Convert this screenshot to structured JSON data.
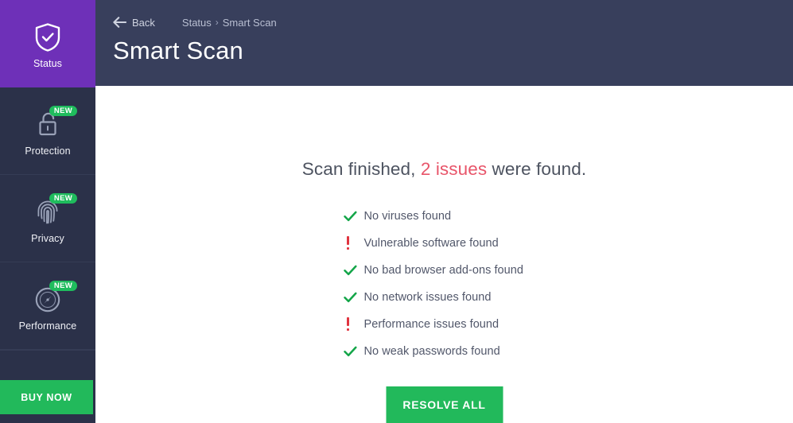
{
  "colors": {
    "sidebar_bg": "#2b3149",
    "sidebar_active": "#6e30b8",
    "header_bg": "#383f5c",
    "accent_green": "#22b95b",
    "badge_green": "#1fbc5d",
    "issue_red": "#e8556a",
    "alert_red": "#e0343f",
    "check_green": "#13a548",
    "content_bg": "#ffffff",
    "body_text": "#51576a"
  },
  "sidebar": {
    "items": [
      {
        "label": "Status",
        "icon": "shield-check-icon",
        "active": true,
        "badge": null
      },
      {
        "label": "Protection",
        "icon": "open-padlock-icon",
        "active": false,
        "badge": "NEW"
      },
      {
        "label": "Privacy",
        "icon": "fingerprint-icon",
        "active": false,
        "badge": "NEW"
      },
      {
        "label": "Performance",
        "icon": "speedometer-icon",
        "active": false,
        "badge": "NEW"
      }
    ],
    "buy_now_label": "BUY NOW"
  },
  "header": {
    "back_label": "Back",
    "back_icon": "arrow-left-icon",
    "breadcrumb": {
      "parent": "Status",
      "separator": "›",
      "current": "Smart Scan"
    },
    "title": "Smart Scan"
  },
  "content": {
    "summary": {
      "prefix": "Scan finished, ",
      "highlight": "2 issues",
      "suffix": " were found."
    },
    "results": [
      {
        "text": "No viruses found",
        "status": "ok",
        "icon": "check-icon"
      },
      {
        "text": "Vulnerable software found",
        "status": "issue",
        "icon": "exclamation-icon"
      },
      {
        "text": "No bad browser add-ons found",
        "status": "ok",
        "icon": "check-icon"
      },
      {
        "text": "No network issues found",
        "status": "ok",
        "icon": "check-icon"
      },
      {
        "text": "Performance issues found",
        "status": "issue",
        "icon": "exclamation-icon"
      },
      {
        "text": "No weak passwords found",
        "status": "ok",
        "icon": "check-icon"
      }
    ],
    "resolve_all_label": "RESOLVE ALL"
  }
}
